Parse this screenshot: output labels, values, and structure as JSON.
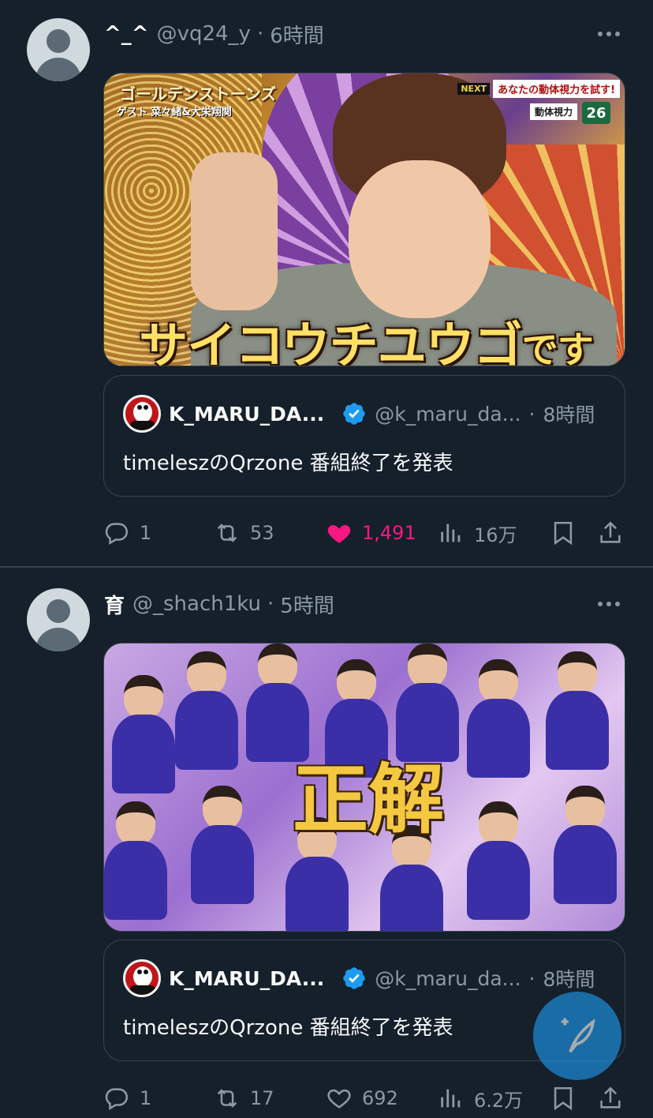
{
  "tweets": [
    {
      "display_name": "^_^",
      "handle": "@vq24_y",
      "separator": "·",
      "time": "6時間",
      "media": {
        "logo_text": "ゴールデンストーンズ",
        "guest_text": "ゲスト 菜々緒&大栄翔関",
        "next_tag": "NEXT",
        "next_text": "あなたの動体視力を試す!",
        "next_sub": "動体視力",
        "next_num": "26",
        "caption_main": "サイコウチユウゴ",
        "caption_suffix": "です"
      },
      "quote": {
        "name": "K_MARU_DA...",
        "handle": "@k_maru_da...",
        "separator": "·",
        "time": "8時間",
        "text": "timeleszのQrzone 番組終了を発表"
      },
      "stats": {
        "replies": "1",
        "retweets": "53",
        "likes": "1,491",
        "views": "16万"
      },
      "liked": true
    },
    {
      "display_name": "育",
      "handle": "@_shach1ku",
      "separator": "·",
      "time": "5時間",
      "media": {
        "caption_main": "正解"
      },
      "quote": {
        "name": "K_MARU_DA...",
        "handle": "@k_maru_da...",
        "separator": "·",
        "time": "8時間",
        "text": "timeleszのQrzone 番組終了を発表"
      },
      "stats": {
        "replies": "1",
        "retweets": "17",
        "likes": "692",
        "views": "6.2万"
      },
      "liked": false
    }
  ],
  "icons": {
    "reply": "reply-icon",
    "retweet": "retweet-icon",
    "like": "heart-icon",
    "views": "views-icon",
    "bookmark": "bookmark-icon",
    "share": "share-icon",
    "more": "more-icon",
    "verified": "verified-badge-icon",
    "compose": "compose-icon"
  },
  "colors": {
    "background": "#15202b",
    "text_primary": "#f7f9f9",
    "text_secondary": "#8b98a5",
    "border": "#38444d",
    "accent": "#1d9bf0",
    "like": "#f91880"
  }
}
